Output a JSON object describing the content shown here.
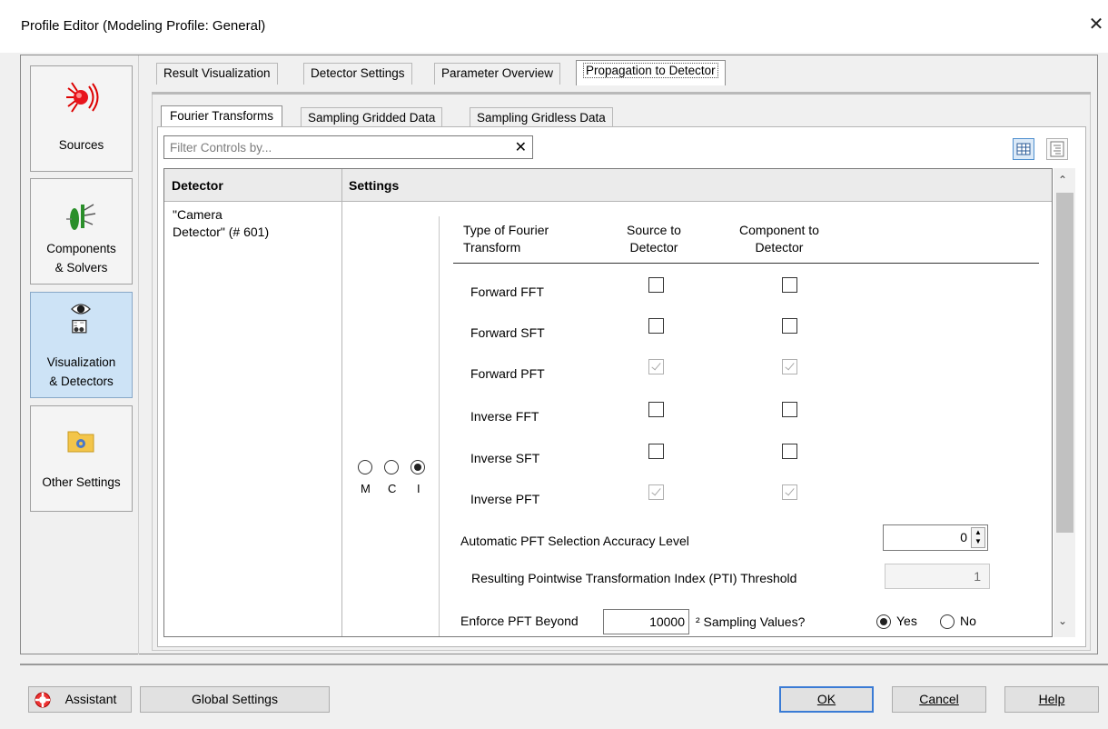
{
  "window": {
    "title": "Profile Editor (Modeling Profile: General)",
    "close_glyph": "✕"
  },
  "left_nav": {
    "items": [
      {
        "label": "Sources",
        "icon": "light-source-icon"
      },
      {
        "label": "Components\n& Solvers",
        "icon": "optical-components-icon"
      },
      {
        "label": "Visualization\n& Detectors",
        "icon": "eye-detector-icon",
        "selected": true
      },
      {
        "label": "Other Settings",
        "icon": "settings-folder-icon"
      }
    ]
  },
  "main_tabs": [
    {
      "label": "Result Visualization"
    },
    {
      "label": "Detector Settings"
    },
    {
      "label": "Parameter Overview"
    },
    {
      "label": "Propagation to Detector",
      "active": true
    }
  ],
  "sub_tabs": [
    {
      "label": "Fourier Transforms",
      "active": true
    },
    {
      "label": "Sampling Gridded Data"
    },
    {
      "label": "Sampling Gridless Data"
    }
  ],
  "filter": {
    "placeholder": "Filter Controls by...",
    "clear_glyph": "✕"
  },
  "grid": {
    "header_detector": "Detector",
    "header_settings": "Settings",
    "detector_name": "\"Camera\nDetector\" (# 601)",
    "mode_radios": {
      "labels": [
        "M",
        "C",
        "I"
      ],
      "selected": "I"
    },
    "ft_table": {
      "col_type": "Type of Fourier\nTransform",
      "col_source": "Source to\nDetector",
      "col_component": "Component to\nDetector",
      "rows": [
        {
          "label": "Forward FFT",
          "source": "unchecked",
          "component": "unchecked"
        },
        {
          "label": "Forward SFT",
          "source": "unchecked",
          "component": "unchecked"
        },
        {
          "label": "Forward PFT",
          "source": "checked-disabled",
          "component": "checked-disabled"
        },
        {
          "label": "Inverse FFT",
          "source": "unchecked",
          "component": "unchecked"
        },
        {
          "label": "Inverse SFT",
          "source": "unchecked",
          "component": "unchecked"
        },
        {
          "label": "Inverse PFT",
          "source": "checked-disabled",
          "component": "checked-disabled"
        }
      ]
    },
    "accuracy": {
      "label": "Automatic PFT Selection Accuracy Level",
      "value": "0"
    },
    "pti": {
      "label": "Resulting Pointwise Transformation Index (PTI) Threshold",
      "value": "1"
    },
    "enforce": {
      "label": "Enforce PFT Beyond",
      "value": "10000",
      "suffix": "² Sampling Values?",
      "yes": "Yes",
      "no": "No",
      "selected": "Yes"
    }
  },
  "bottom": {
    "assistant": "Assistant",
    "global_settings": "Global Settings",
    "ok": "OK",
    "cancel": "Cancel",
    "help": "Help"
  },
  "colors": {
    "selected_nav": "#cde3f6",
    "default_button_border": "#3a7bd5"
  }
}
